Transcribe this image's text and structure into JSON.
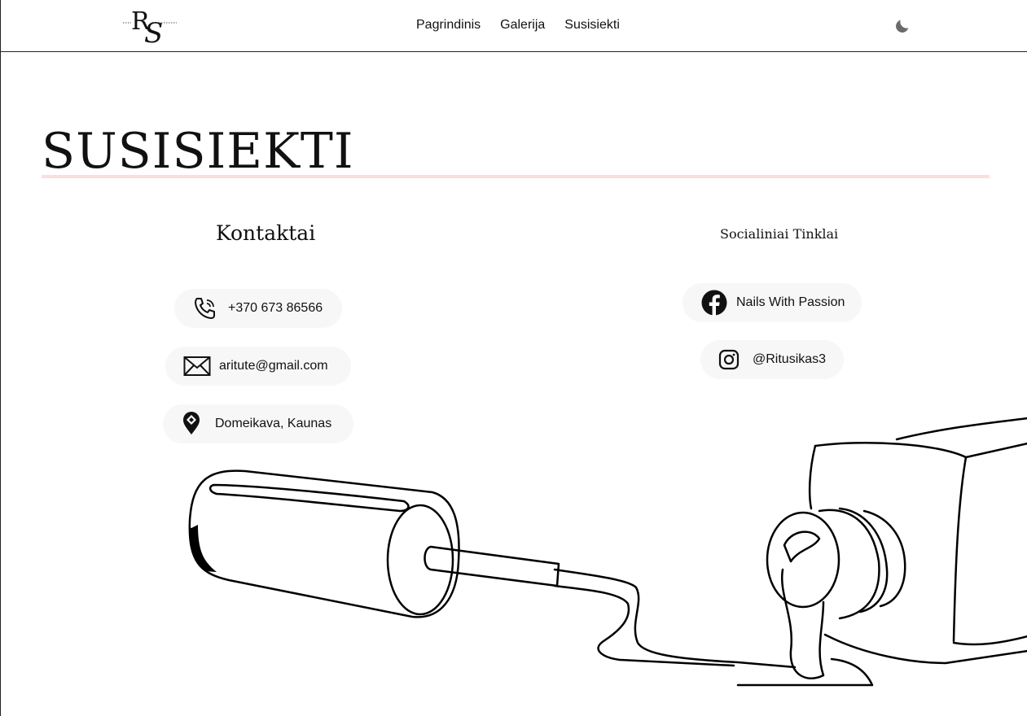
{
  "nav": {
    "links": [
      "Pagrindinis",
      "Galerija",
      "Susisiekti"
    ],
    "theme_icon": "moon-icon"
  },
  "logo": {
    "text": "RS",
    "icon": "rs-monogram-logo"
  },
  "page": {
    "title": "SUSISIEKTI"
  },
  "contacts": {
    "heading": "Kontaktai",
    "items": [
      {
        "icon": "phone-icon",
        "text": "+370 673 86566"
      },
      {
        "icon": "envelope-icon",
        "text": "aritute@gmail.com"
      },
      {
        "icon": "location-pin-icon",
        "text": "Domeikava, Kaunas"
      }
    ]
  },
  "social": {
    "heading": "Socialiniai Tinklai",
    "items": [
      {
        "icon": "facebook-icon",
        "text": "Nails With Passion"
      },
      {
        "icon": "instagram-icon",
        "text": "@Ritusikas3"
      }
    ]
  },
  "colors": {
    "accent_rule": "#f9dede",
    "pill_bg": "#f7f7f7",
    "text": "#111111"
  }
}
